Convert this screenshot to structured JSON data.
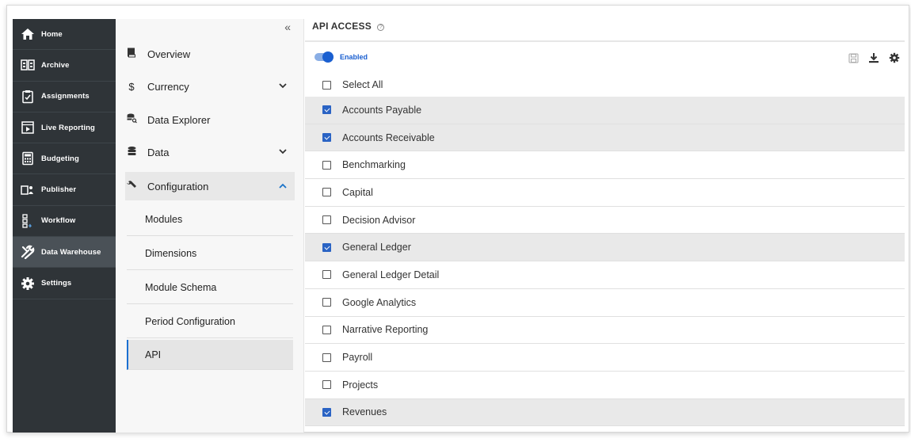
{
  "nav": {
    "items": [
      {
        "label": "Home",
        "icon": "home-icon"
      },
      {
        "label": "Archive",
        "icon": "archive-icon"
      },
      {
        "label": "Assignments",
        "icon": "clipboard-icon"
      },
      {
        "label": "Live Reporting",
        "icon": "live-report-icon"
      },
      {
        "label": "Budgeting",
        "icon": "calculator-icon"
      },
      {
        "label": "Publisher",
        "icon": "publisher-icon"
      },
      {
        "label": "Workflow",
        "icon": "workflow-icon"
      },
      {
        "label": "Data Warehouse",
        "icon": "tools-icon",
        "active": true
      },
      {
        "label": "Settings",
        "icon": "gear-icon"
      }
    ]
  },
  "subnav": {
    "collapse_glyph": "«",
    "items": [
      {
        "label": "Overview",
        "icon": "book-icon"
      },
      {
        "label": "Currency",
        "icon": "dollar-icon",
        "chevron": "down"
      },
      {
        "label": "Data Explorer",
        "icon": "database-search-icon"
      },
      {
        "label": "Data",
        "icon": "database-icon",
        "chevron": "down"
      },
      {
        "label": "Configuration",
        "icon": "wrench-icon",
        "chevron": "up",
        "open": true
      }
    ],
    "children": [
      {
        "label": "Modules"
      },
      {
        "label": "Dimensions"
      },
      {
        "label": "Module Schema"
      },
      {
        "label": "Period Configuration"
      },
      {
        "label": "API",
        "selected": true
      }
    ]
  },
  "content": {
    "title": "API ACCESS",
    "help_glyph": "?",
    "toggle": {
      "label": "Enabled",
      "on": true
    },
    "actions": [
      "save-icon",
      "download-icon",
      "gear-icon"
    ],
    "select_all": "Select All",
    "modules": [
      {
        "label": "Accounts Payable",
        "checked": true
      },
      {
        "label": "Accounts Receivable",
        "checked": true
      },
      {
        "label": "Benchmarking",
        "checked": false
      },
      {
        "label": "Capital",
        "checked": false
      },
      {
        "label": "Decision Advisor",
        "checked": false
      },
      {
        "label": "General Ledger",
        "checked": true
      },
      {
        "label": "General Ledger Detail",
        "checked": false
      },
      {
        "label": "Google Analytics",
        "checked": false
      },
      {
        "label": "Narrative Reporting",
        "checked": false
      },
      {
        "label": "Payroll",
        "checked": false
      },
      {
        "label": "Projects",
        "checked": false
      },
      {
        "label": "Revenues",
        "checked": true
      }
    ]
  },
  "colors": {
    "nav_bg": "#2f3438",
    "accent": "#1a5fd0",
    "checkbox_checked": "#2a63c4",
    "row_checked_bg": "#e9e9e9"
  }
}
